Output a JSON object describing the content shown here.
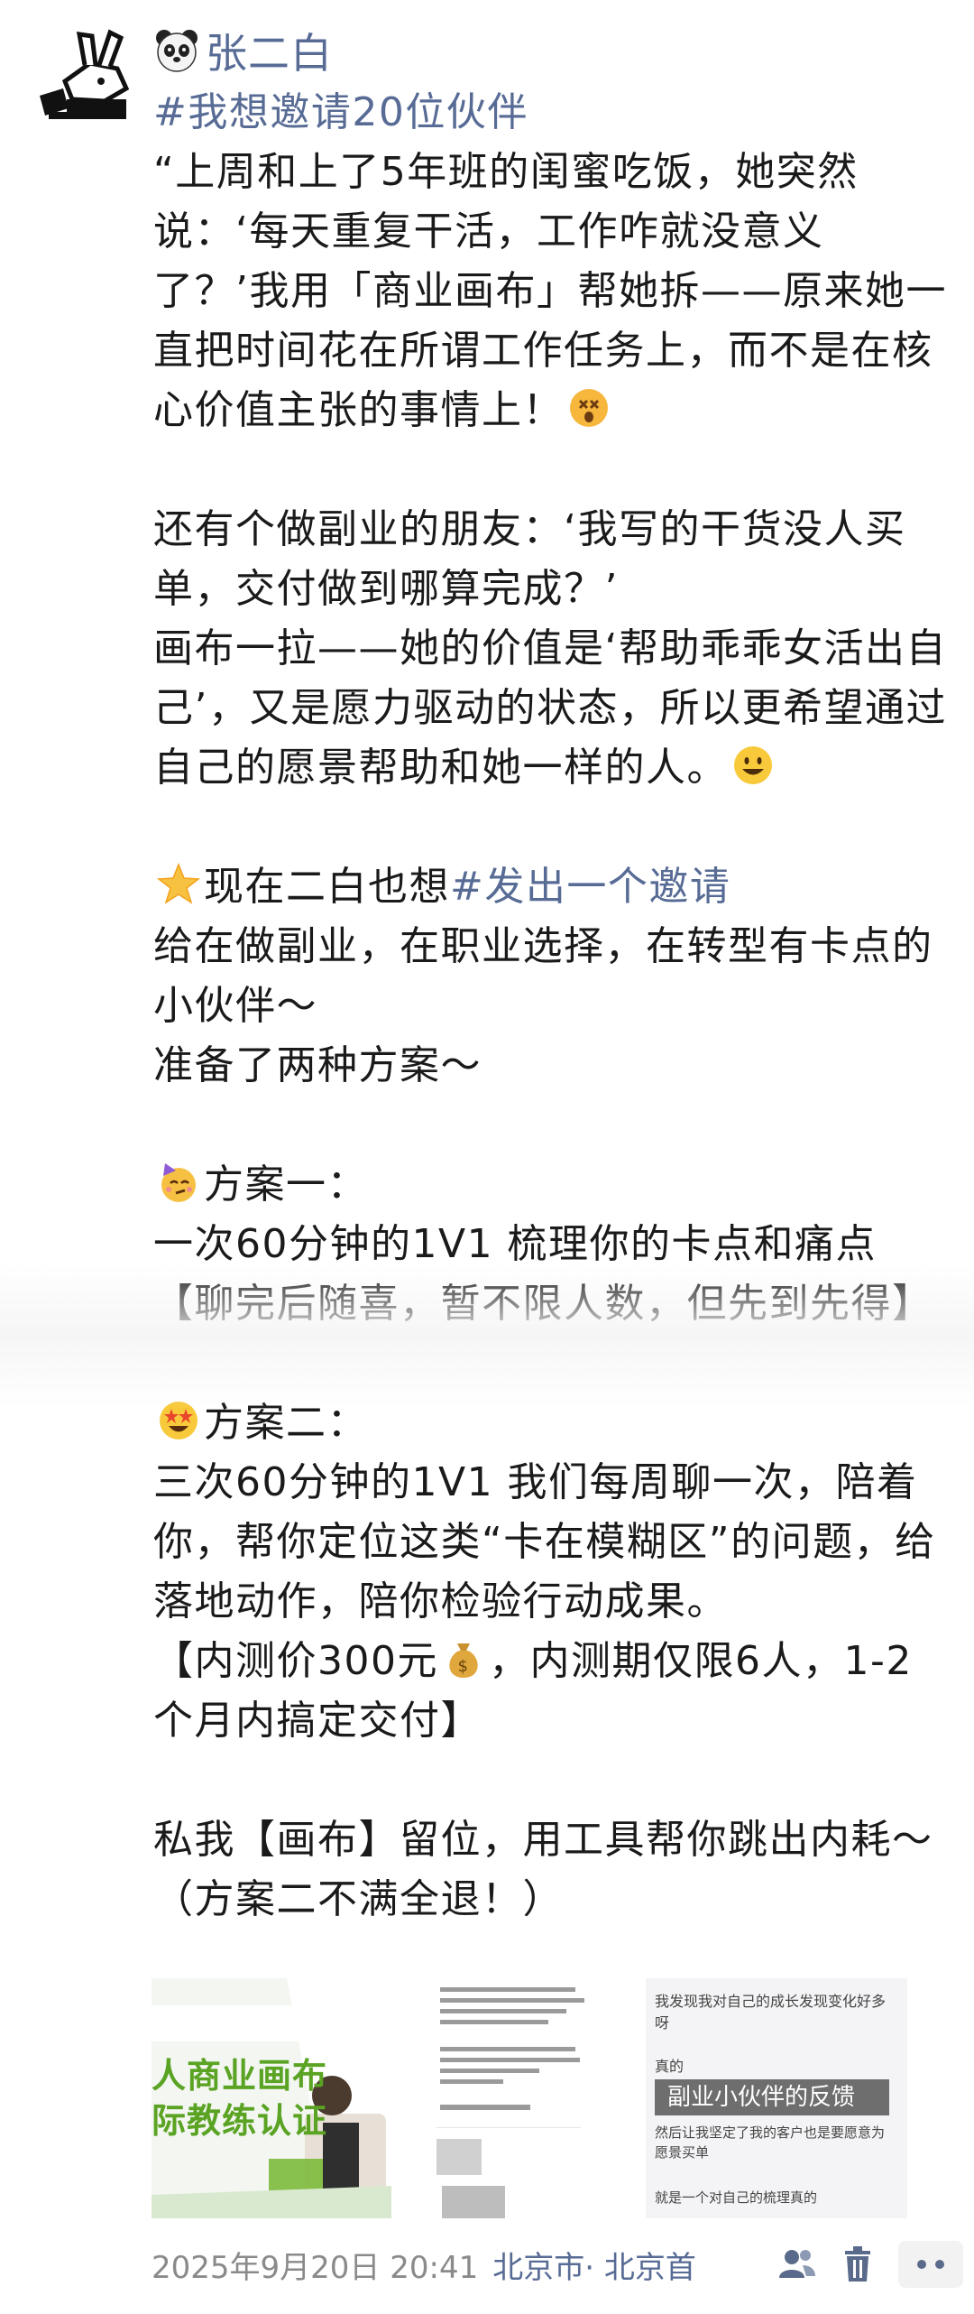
{
  "post": {
    "author_name": "张二白",
    "paragraphs": [
      {
        "id": "l1",
        "type": "link",
        "text": "#我想邀请20位伙伴"
      },
      {
        "id": "l2",
        "type": "text",
        "text": "“上周和上了5年班的闺蜜吃饭，她突然说：‘每天重复干活，工作咋就没意义了？’我用「商业画布」帮她拆——原来她一直把时间花在所谓工作任务上，而不是在核心价值主张的事情上！"
      },
      {
        "id": "l3",
        "type": "text",
        "text": "还有个做副业的朋友：‘我写的干货没人买单，交付做到哪算完成？’"
      },
      {
        "id": "l4",
        "type": "text",
        "text": "画布一拉——她的价值是‘帮助乖乖女活出自己’，又是愿力驱动的状态，所以更希望通过自己的愿景帮助和她一样的人。"
      },
      {
        "id": "l5a",
        "type": "text",
        "text": "现在二白也想"
      },
      {
        "id": "l5b",
        "type": "link",
        "text": "#发出一个邀请"
      },
      {
        "id": "l6",
        "type": "text",
        "text": "给在做副业，在职业选择，在转型有卡点的小伙伴～"
      },
      {
        "id": "l7",
        "type": "text",
        "text": "准备了两种方案～"
      },
      {
        "id": "l8",
        "type": "text",
        "text": "方案一："
      },
      {
        "id": "l9",
        "type": "text",
        "text": "一次60分钟的1V1 梳理你的卡点和痛点【聊完后随喜，暂不限人数，但先到先得】"
      },
      {
        "id": "l10",
        "type": "text",
        "text": "方案二："
      },
      {
        "id": "l11",
        "type": "text",
        "text": "三次60分钟的1V1 我们每周聊一次，陪着你，帮你定位这类“卡在模糊区”的问题，给落地动作，陪你检验行动成果。"
      },
      {
        "id": "l12a",
        "type": "text",
        "text": "【内测价300元"
      },
      {
        "id": "l12b",
        "type": "text",
        "text": "，内测期仅限6人，1-2个月内搞定交付】"
      },
      {
        "id": "l13",
        "type": "text",
        "text": "私我【画布】留位，用工具帮你跳出内耗～（方案二不满全退！）"
      }
    ],
    "emojis": {
      "author": "panda-face",
      "l2": "dizzy-face",
      "l4": "smiley-face",
      "l5": "glowing-star",
      "l8": "partying-face",
      "l10": "star-struck-face",
      "l12": "money-bag"
    },
    "images": [
      {
        "name": "poster-image",
        "label_1": "人商业画布",
        "label_2": "际教练认证"
      },
      {
        "name": "chat-screenshot-image"
      },
      {
        "name": "feedback-image",
        "overlay": "副业小伙伴的反馈",
        "line_1": "我发现我对自己的成长发现变化好多呀",
        "line_2": "真的",
        "line_3": "然后让我坚定了我的客户也是要愿意为愿景买单",
        "line_4": "就是一个对自己的梳理真的"
      }
    ],
    "footer": {
      "datetime": "2025年9月20日 20:41",
      "location": "北京市",
      "location_detail": " · 北京首"
    }
  },
  "colors": {
    "link": "#576b95",
    "text": "#1a1a1a",
    "meta": "#8a8a8a"
  }
}
